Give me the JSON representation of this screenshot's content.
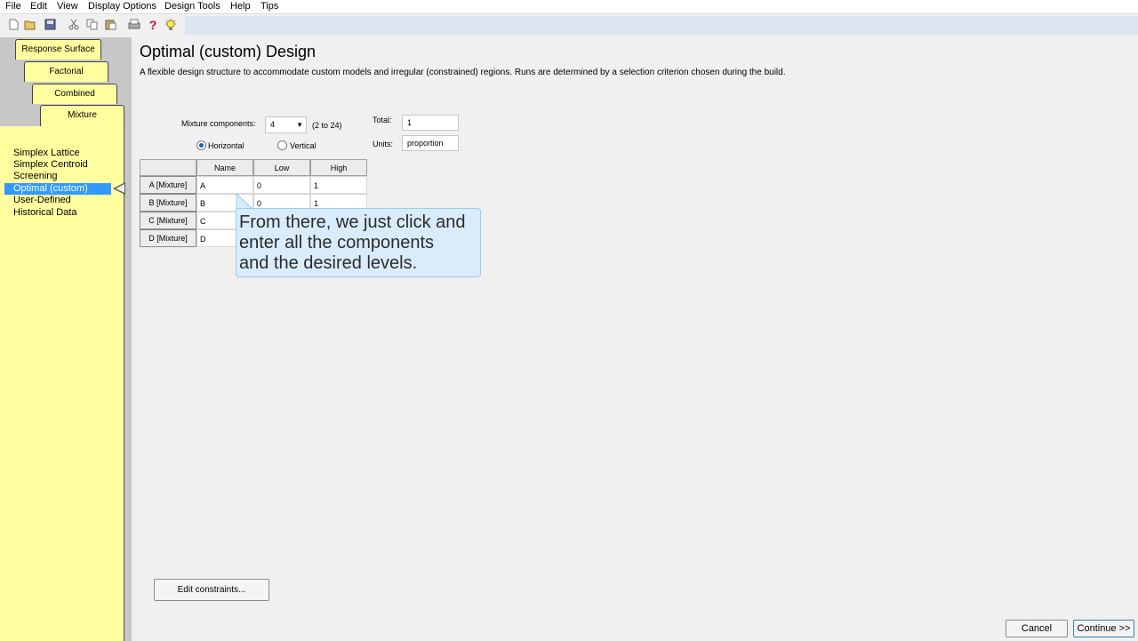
{
  "menu": [
    "File",
    "Edit",
    "View",
    "Display Options",
    "Design Tools",
    "Help",
    "Tips"
  ],
  "toolbar": {
    "icons": [
      "new-document-icon",
      "open-folder-icon",
      "save-icon",
      "cut-icon",
      "copy-icon",
      "paste-icon",
      "print-icon",
      "help-question-icon",
      "tip-lightbulb-icon"
    ],
    "help_glyph": "?"
  },
  "tabs": [
    "Response Surface",
    "Factorial",
    "Combined",
    "Mixture"
  ],
  "nav": {
    "items": [
      "Simplex Lattice",
      "Simplex Centroid",
      "Screening",
      "Optimal (custom)",
      "User-Defined",
      "Historical Data"
    ],
    "selected": "Optimal (custom)"
  },
  "page": {
    "title": "Optimal (custom) Design",
    "description": "A flexible design structure to accommodate custom models and irregular (constrained) regions.  Runs are determined by a selection criterion chosen during the build."
  },
  "form": {
    "mixture_label": "Mixture components:",
    "mixture_value": "4",
    "mixture_range": "(2 to 24)",
    "total_label": "Total:",
    "total_value": "1",
    "units_label": "Units:",
    "units_value": "proportion",
    "orientation": {
      "horizontal": "Horizontal",
      "vertical": "Vertical",
      "selected": "Horizontal"
    }
  },
  "table": {
    "columns": [
      "Name",
      "Low",
      "High"
    ],
    "rows": [
      {
        "header": "A [Mixture]",
        "name": "A",
        "low": "0",
        "high": "1"
      },
      {
        "header": "B [Mixture]",
        "name": "B",
        "low": "0",
        "high": "1"
      },
      {
        "header": "C [Mixture]",
        "name": "C",
        "low": "",
        "high": ""
      },
      {
        "header": "D [Mixture]",
        "name": "D",
        "low": "",
        "high": ""
      }
    ]
  },
  "callout": {
    "line1": "From there, we just click and",
    "line2": "enter all the components",
    "line3": "and the desired levels."
  },
  "buttons": {
    "edit_constraints": "Edit constraints...",
    "cancel": "Cancel",
    "continue": "Continue >>"
  },
  "colors": {
    "tab_yellow": "#ffffa0",
    "selection_blue": "#3399ff",
    "callout_bg": "#d9ecfb"
  }
}
